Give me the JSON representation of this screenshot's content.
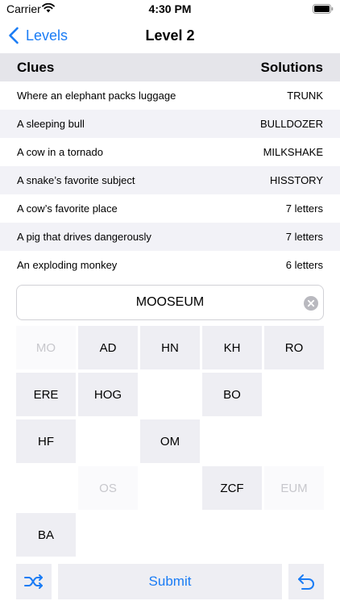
{
  "status": {
    "carrier": "Carrier",
    "time": "4:30 PM"
  },
  "nav": {
    "back_label": "Levels",
    "title": "Level 2"
  },
  "clues": {
    "header_left": "Clues",
    "header_right": "Solutions",
    "rows": [
      {
        "clue": "Where an elephant packs luggage",
        "solution": "TRUNK"
      },
      {
        "clue": "A sleeping bull",
        "solution": "BULLDOZER"
      },
      {
        "clue": "A cow in a tornado",
        "solution": "MILKSHAKE"
      },
      {
        "clue": "A snake’s favorite subject",
        "solution": "HISSTORY"
      },
      {
        "clue": "A cow’s favorite place",
        "solution": "7 letters"
      },
      {
        "clue": "A pig that drives dangerously",
        "solution": "7 letters"
      },
      {
        "clue": "An exploding monkey",
        "solution": "6 letters"
      }
    ]
  },
  "answer": {
    "value": "MOOSEUM"
  },
  "tiles": [
    {
      "label": "MO",
      "state": "used"
    },
    {
      "label": "AD",
      "state": "available"
    },
    {
      "label": "HN",
      "state": "available"
    },
    {
      "label": "KH",
      "state": "available"
    },
    {
      "label": "RO",
      "state": "available"
    },
    {
      "label": "ERE",
      "state": "available"
    },
    {
      "label": "HOG",
      "state": "available"
    },
    {
      "label": "BO",
      "state": "available"
    },
    {
      "label": "HF",
      "state": "available"
    },
    {
      "label": "OM",
      "state": "available"
    },
    {
      "label": "OS",
      "state": "used"
    },
    {
      "label": "ZCF",
      "state": "available"
    },
    {
      "label": "EUM",
      "state": "used"
    },
    {
      "label": "BA",
      "state": "available"
    }
  ],
  "actions": {
    "submit_label": "Submit"
  },
  "icons": {
    "back": "chevron-left-icon",
    "clear": "clear-circle-icon",
    "shuffle": "shuffle-icon",
    "undo": "undo-arrow-icon",
    "wifi": "wifi-icon",
    "battery": "battery-icon"
  },
  "colors": {
    "accent": "#1a7cf5",
    "header_bg": "#e5e5ea",
    "row_alt_bg": "#f2f2f7",
    "tile_bg": "#eeeef3"
  }
}
